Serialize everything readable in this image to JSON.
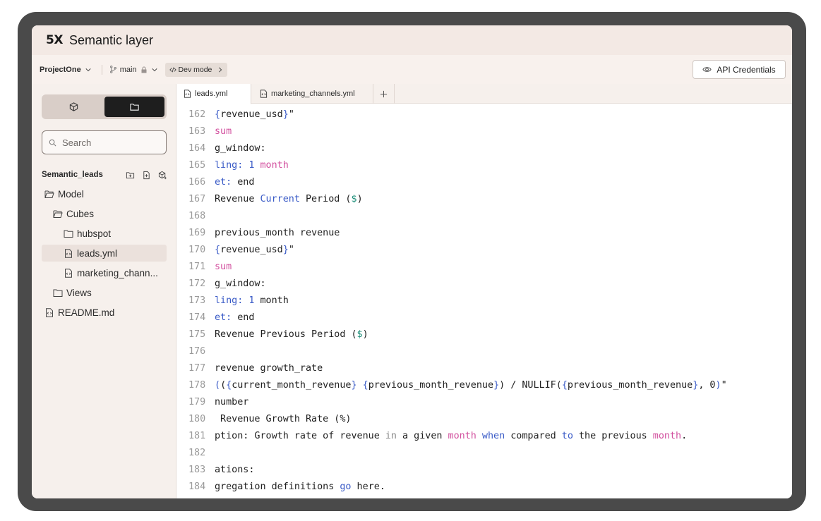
{
  "app": {
    "logo": "5X",
    "title": "Semantic layer"
  },
  "toolbar": {
    "project": "ProjectOne",
    "branch": "main",
    "dev_mode": "Dev mode",
    "api_credentials": "API Credentials"
  },
  "sidebar": {
    "search_placeholder": "Search",
    "section_title": "Semantic_leads",
    "tree": [
      {
        "label": "Model",
        "type": "folder-open",
        "depth": 0
      },
      {
        "label": "Cubes",
        "type": "folder-open",
        "depth": 1
      },
      {
        "label": "hubspot",
        "type": "folder",
        "depth": 2
      },
      {
        "label": "leads.yml",
        "type": "file",
        "depth": 2,
        "selected": true
      },
      {
        "label": "marketing_chann...",
        "type": "file",
        "depth": 2
      },
      {
        "label": "Views",
        "type": "folder",
        "depth": 1
      },
      {
        "label": "README.md",
        "type": "file",
        "depth": 0
      }
    ]
  },
  "tabs": [
    {
      "label": "leads.yml",
      "active": true
    },
    {
      "label": "marketing_channels.yml",
      "active": false
    }
  ],
  "code_lines": [
    {
      "n": "162",
      "tokens": [
        [
          "b",
          "{"
        ],
        [
          "t",
          "revenue_usd"
        ],
        [
          "b",
          "}"
        ],
        [
          "t",
          "\""
        ]
      ]
    },
    {
      "n": "163",
      "tokens": [
        [
          "p",
          "sum"
        ]
      ]
    },
    {
      "n": "164",
      "tokens": [
        [
          "t",
          "g_window:"
        ]
      ]
    },
    {
      "n": "165",
      "tokens": [
        [
          "b",
          "ling:"
        ],
        [
          "t",
          " "
        ],
        [
          "b",
          "1"
        ],
        [
          "t",
          " "
        ],
        [
          "p",
          "month"
        ]
      ]
    },
    {
      "n": "166",
      "tokens": [
        [
          "b",
          "et:"
        ],
        [
          "t",
          " end"
        ]
      ]
    },
    {
      "n": "167",
      "tokens": [
        [
          "t",
          "Revenue "
        ],
        [
          "b",
          "Current"
        ],
        [
          "t",
          " Period ("
        ],
        [
          "g",
          "$"
        ],
        [
          "t",
          ")"
        ]
      ]
    },
    {
      "n": "168",
      "tokens": []
    },
    {
      "n": "169",
      "tokens": [
        [
          "t",
          "previous_month revenue"
        ]
      ]
    },
    {
      "n": "170",
      "tokens": [
        [
          "b",
          "{"
        ],
        [
          "t",
          "revenue_usd"
        ],
        [
          "b",
          "}"
        ],
        [
          "t",
          "\""
        ]
      ]
    },
    {
      "n": "171",
      "tokens": [
        [
          "p",
          "sum"
        ]
      ]
    },
    {
      "n": "172",
      "tokens": [
        [
          "t",
          "g_window:"
        ]
      ]
    },
    {
      "n": "173",
      "tokens": [
        [
          "b",
          "ling:"
        ],
        [
          "t",
          " "
        ],
        [
          "b",
          "1"
        ],
        [
          "t",
          " month"
        ]
      ]
    },
    {
      "n": "174",
      "tokens": [
        [
          "b",
          "et:"
        ],
        [
          "t",
          " end"
        ]
      ]
    },
    {
      "n": "175",
      "tokens": [
        [
          "t",
          "Revenue Previous Period ("
        ],
        [
          "g",
          "$"
        ],
        [
          "t",
          ")"
        ]
      ]
    },
    {
      "n": "176",
      "tokens": []
    },
    {
      "n": "177",
      "tokens": [
        [
          "t",
          "revenue growth_rate"
        ]
      ]
    },
    {
      "n": "178",
      "tokens": [
        [
          "b",
          "("
        ],
        [
          "t",
          "("
        ],
        [
          "b",
          "{"
        ],
        [
          "t",
          "current_month_revenue"
        ],
        [
          "b",
          "}"
        ],
        [
          "t",
          " "
        ],
        [
          "b",
          "{"
        ],
        [
          "t",
          "previous_month_revenue"
        ],
        [
          "b",
          "}"
        ],
        [
          "t",
          ") / NULLIF("
        ],
        [
          "b",
          "{"
        ],
        [
          "t",
          "previous_month_revenue"
        ],
        [
          "b",
          "}"
        ],
        [
          "t",
          ", 0"
        ],
        [
          "b",
          ")"
        ],
        [
          "t",
          "\""
        ]
      ]
    },
    {
      "n": "179",
      "tokens": [
        [
          "t",
          "number"
        ]
      ]
    },
    {
      "n": "180",
      "tokens": [
        [
          "t",
          " Revenue Growth Rate (%)"
        ]
      ]
    },
    {
      "n": "181",
      "tokens": [
        [
          "t",
          "ption: Growth rate of revenue "
        ],
        [
          "x",
          "in"
        ],
        [
          "t",
          " a given "
        ],
        [
          "p",
          "month"
        ],
        [
          "t",
          " "
        ],
        [
          "b",
          "when"
        ],
        [
          "t",
          " compared "
        ],
        [
          "b",
          "to"
        ],
        [
          "t",
          " the previous "
        ],
        [
          "p",
          "month"
        ],
        [
          "t",
          "."
        ]
      ]
    },
    {
      "n": "182",
      "tokens": []
    },
    {
      "n": "183",
      "tokens": [
        [
          "t",
          "ations:"
        ]
      ]
    },
    {
      "n": "184",
      "tokens": [
        [
          "t",
          "gregation definitions "
        ],
        [
          "b",
          "go"
        ],
        [
          "t",
          " here."
        ]
      ]
    }
  ]
}
